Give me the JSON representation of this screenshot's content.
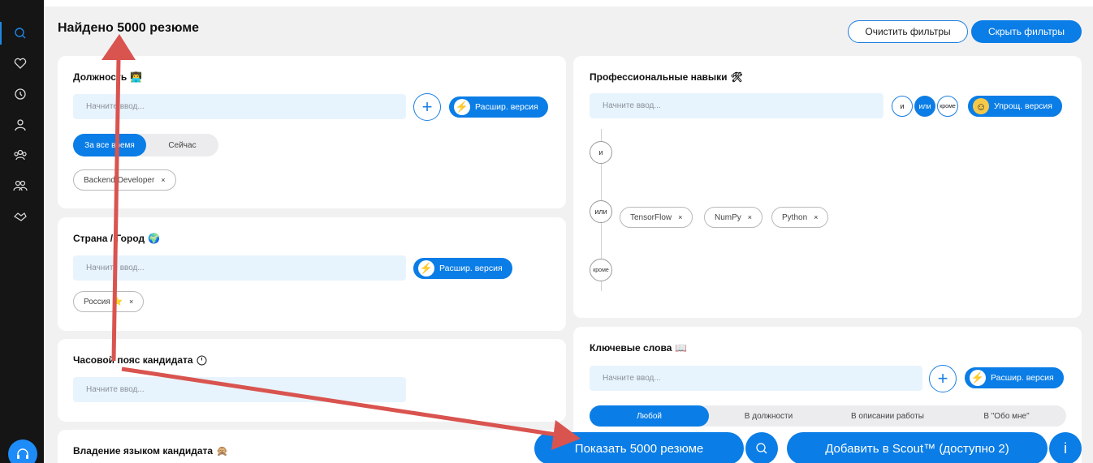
{
  "header": {
    "found_text": "Найдено 5000 резюме",
    "clear_filters": "Очистить фильтры",
    "hide_filters": "Скрыть фильтры"
  },
  "sidebar": {
    "icons": [
      "search-icon",
      "heart-icon",
      "history-icon",
      "user-icon",
      "group-icon",
      "team-icon",
      "handshake-icon"
    ],
    "support_icon": "headset-icon"
  },
  "position_card": {
    "title": "Должность",
    "title_emoji": "👨‍💻",
    "placeholder": "Начните ввод...",
    "extended_label": "Расшир. версия",
    "segments": [
      "За все время",
      "Сейчас"
    ],
    "active_segment": "За все время",
    "tags": [
      "Backend Developer"
    ]
  },
  "location_card": {
    "title": "Страна / Город",
    "title_emoji": "🌍",
    "placeholder": "Начните ввод...",
    "extended_label": "Расшир. версия",
    "tags": [
      "Россия ⭐"
    ]
  },
  "timezone_card": {
    "title": "Часовой пояс кандидата",
    "placeholder": "Начните ввод..."
  },
  "language_card": {
    "title": "Владение языком кандидата",
    "title_emoji": "🙊"
  },
  "skills_card": {
    "title": "Профессиональные навыки",
    "title_emoji": "🛠",
    "placeholder": "Начните ввод...",
    "logic_buttons": [
      "и",
      "или",
      "кроме"
    ],
    "active_logic": "или",
    "simple_label": "Упрощ. версия",
    "groups": [
      {
        "label": "и",
        "tags": []
      },
      {
        "label": "или",
        "tags": [
          "TensorFlow",
          "NumPy",
          "Python"
        ]
      },
      {
        "label": "кроме",
        "tags": []
      }
    ]
  },
  "keywords_card": {
    "title": "Ключевые слова",
    "title_emoji": "📖",
    "placeholder": "Начните ввод...",
    "extended_label": "Расшир. версия",
    "segments": [
      "Любой",
      "В должности",
      "В описании работы",
      "В \"Обо мне\""
    ],
    "active_segment": "Любой"
  },
  "bottom_bar": {
    "show_label": "Показать 5000 резюме",
    "add_label": "Добавить в Scout™ (доступно 2)",
    "info_label": "i"
  },
  "colors": {
    "accent": "#0a7de6",
    "input_bg": "#e8f4fd",
    "annotation_arrow": "#d9534f"
  }
}
